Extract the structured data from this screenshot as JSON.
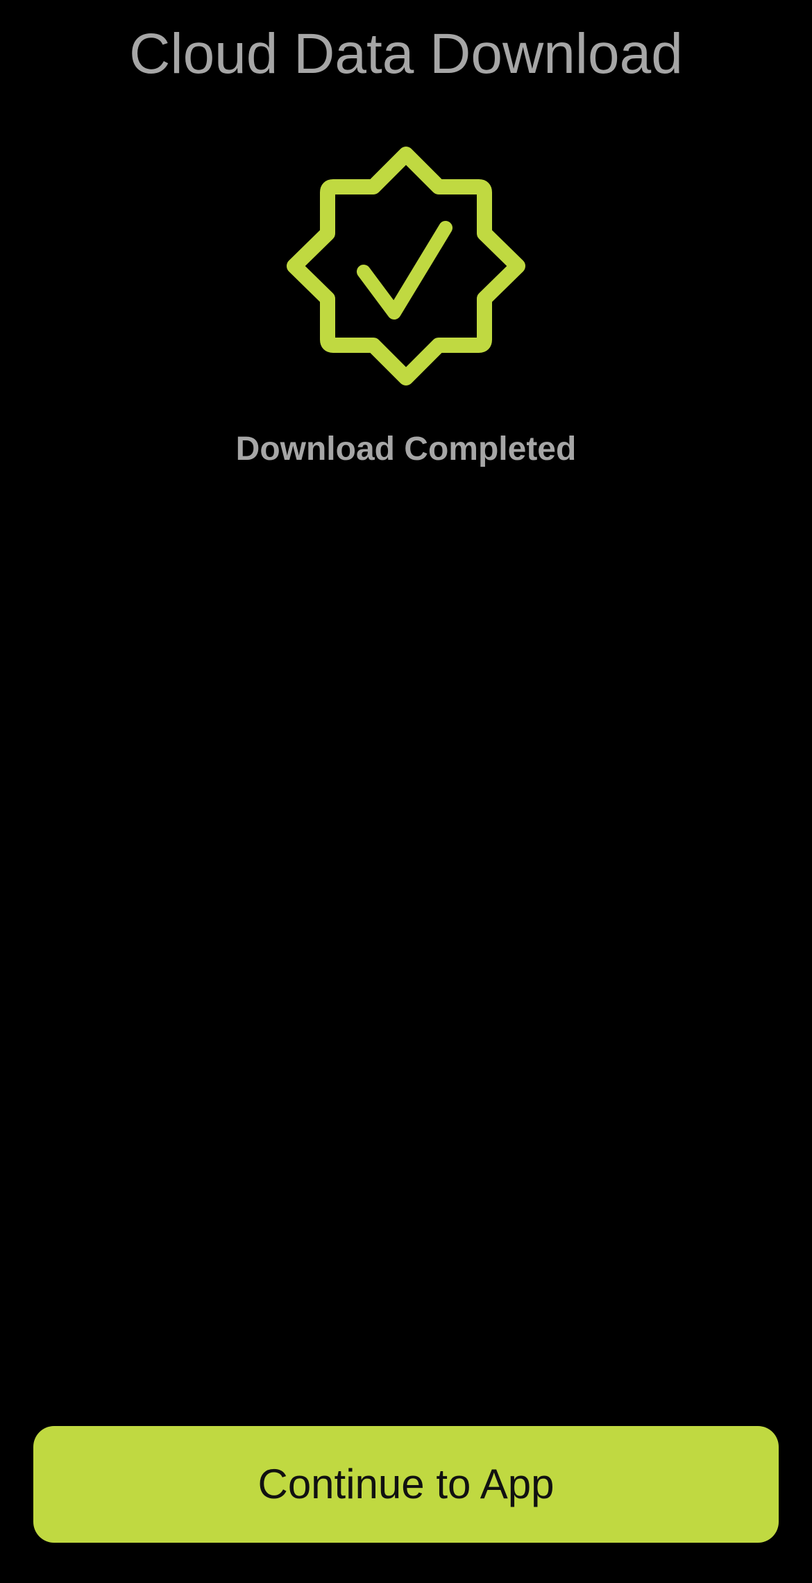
{
  "header": {
    "title": "Cloud Data Download"
  },
  "status": {
    "icon": "checkmark-seal-icon",
    "message": "Download Completed"
  },
  "footer": {
    "continue_label": "Continue to App"
  },
  "colors": {
    "accent": "#c0d941",
    "background": "#000000",
    "text_muted": "#a6a6a6"
  }
}
